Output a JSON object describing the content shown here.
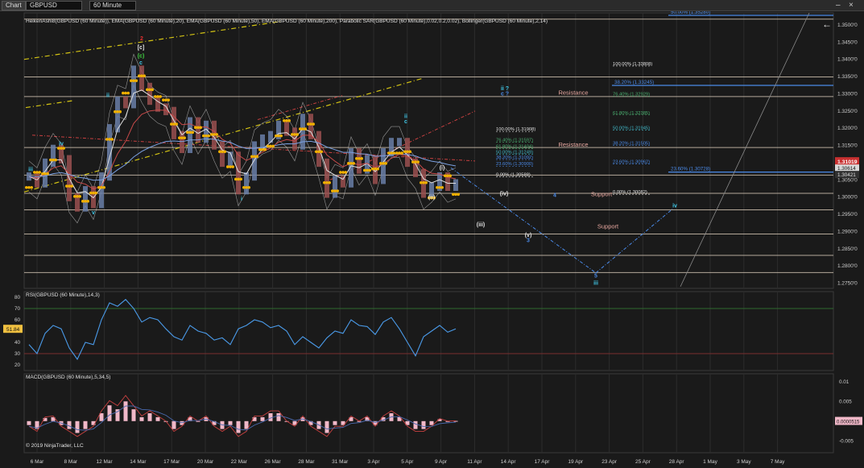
{
  "toolbar": {
    "chart_label": "Chart",
    "instrument": "GBPUSD",
    "timeframe": "60 Minute",
    "back_arrow": "←",
    "close": "×",
    "minimize": "–",
    "icons": [
      "chevron-down-icon",
      "back-arrow-icon",
      "close-icon"
    ]
  },
  "panels": {
    "price": {
      "indicators_label": "HeikenAshi8(GBPUSD (60 Minute)), EMA(GBPUSD (60 Minute),20), EMA(GBPUSD (60 Minute),50), EMA(GBPUSD (60 Minute),200), Parabolic SAR(GBPUSD (60 Minute),0.02,0.2,0.02), Bollinger(GBPUSD (60 Minute),2,14)"
    },
    "rsi": {
      "label": "RSI(GBPUSD (60 Minute),14,3)",
      "current_label": "51.84"
    },
    "macd": {
      "label": "MACD(GBPUSD (60 Minute),5,34,5)",
      "copyright": "© 2019 NinjaTrader, LLC",
      "current_label": "0.0000515"
    }
  },
  "colors": {
    "background": "#1a1a1a",
    "grid": "#2c2c2c",
    "level_line": "#e8d8c4",
    "yellow_channel": "#d4c414",
    "red_channel": "#c84040",
    "fib_blue": "#4a8ae8",
    "sar": "#f0b000",
    "rsi_line": "#4a9ae8",
    "macd_hist": "#f0b8c8",
    "wave_cyan": "#40c8e8",
    "current_price_bg": "#c83030",
    "rsi_tag": "#f0c040"
  },
  "chart_data": [
    {
      "name": "price",
      "type": "line",
      "x_tick_labels": [
        "6 Mar",
        "8 Mar",
        "12 Mar",
        "14 Mar",
        "17 Mar",
        "20 Mar",
        "22 Mar",
        "26 Mar",
        "28 Mar",
        "31 Mar",
        "3 Apr",
        "5 Apr",
        "9 Apr",
        "11 Apr",
        "14 Apr",
        "17 Apr",
        "19 Apr",
        "23 Apr",
        "25 Apr",
        "28 Apr",
        "1 May",
        "3 May",
        "7 May"
      ],
      "y_ticks": [
        1.275,
        1.28,
        1.285,
        1.29,
        1.295,
        1.3,
        1.305,
        1.31,
        1.315,
        1.32,
        1.325,
        1.33,
        1.335,
        1.34,
        1.345,
        1.35
      ],
      "y_tick_labels": [
        "1.2750'0",
        "1.2800'0",
        "1.2850'0",
        "1.2900'0",
        "1.2950'0",
        "1.3000'0",
        "1.3050'0",
        "1.3100'0",
        "1.3150'0",
        "1.3200'0",
        "1.3250'0",
        "1.3300'0",
        "1.3350'0",
        "1.3400'0",
        "1.3450'0",
        "1.3500'0"
      ],
      "ylim": [
        1.2735,
        1.3535
      ],
      "current_price": 1.31019,
      "current_price_label": "1.31019",
      "side_labels": [
        "1.30614",
        "1.30421"
      ],
      "close_series": [
        1.306,
        1.304,
        1.31,
        1.314,
        1.311,
        1.3,
        1.297,
        1.302,
        1.298,
        1.306,
        1.32,
        1.328,
        1.327,
        1.337,
        1.332,
        1.328,
        1.326,
        1.325,
        1.318,
        1.314,
        1.322,
        1.317,
        1.321,
        1.315,
        1.31,
        1.312,
        1.302,
        1.306,
        1.315,
        1.317,
        1.318,
        1.321,
        1.319,
        1.315,
        1.323,
        1.318,
        1.31,
        1.301,
        1.305,
        1.304,
        1.313,
        1.308,
        1.311,
        1.305,
        1.313,
        1.316,
        1.316,
        1.31,
        1.307,
        1.301,
        1.303,
        1.306,
        1.303,
        1.304
      ],
      "horizontal_levels": [
        1.3517,
        1.3349,
        1.3292,
        1.3144,
        1.3064,
        1.3011,
        1.2963,
        1.2893,
        1.2831,
        1.2781
      ],
      "level_labels": [
        {
          "text": "Resistance",
          "y": 1.3535
        },
        {
          "text": "Resistance",
          "y": 1.3293
        },
        {
          "text": "Resistance",
          "y": 1.3142
        },
        {
          "text": "Support",
          "y": 1.2998
        },
        {
          "text": "Support",
          "y": 1.2905
        }
      ],
      "fib_lines": [
        {
          "value": 1.3528,
          "label": "50.00% (1.35280)"
        },
        {
          "value": 1.33245,
          "label": "38.20% (1.33245)"
        },
        {
          "value": 1.30728,
          "label": "23.60% (1.30728)"
        }
      ],
      "fib_sets": [
        [
          {
            "label": "100.00% (1.31908)",
            "y": 1.31908,
            "color": "#e0e0e0"
          },
          {
            "label": "76.40% (1.31597)",
            "y": 1.31597,
            "color": "#4ab070"
          },
          {
            "label": "61.80% (1.31404)",
            "y": 1.31404,
            "color": "#4ab070"
          },
          {
            "label": "50.00% (1.31249)",
            "y": 1.31249,
            "color": "#40b8c8"
          },
          {
            "label": "38.20% (1.31092)",
            "y": 1.31092,
            "color": "#4a8ae8"
          },
          {
            "label": "23.60% (1.30900)",
            "y": 1.309,
            "color": "#4a8ae8"
          },
          {
            "label": "0.00% (1.30588)",
            "y": 1.30588,
            "color": "#e0e0e0"
          }
        ],
        [
          {
            "label": "100.00% (1.33808)",
            "y": 1.33808,
            "color": "#e0e0e0"
          },
          {
            "label": "76.40% (1.32929)",
            "y": 1.32929,
            "color": "#4ab070"
          },
          {
            "label": "61.80% (1.32385)",
            "y": 1.32385,
            "color": "#4ab070"
          },
          {
            "label": "50.00% (1.31945)",
            "y": 1.31945,
            "color": "#40b8c8"
          },
          {
            "label": "38.20% (1.31505)",
            "y": 1.31505,
            "color": "#4a8ae8"
          },
          {
            "label": "23.60% (1.30962)",
            "y": 1.30962,
            "color": "#4a8ae8"
          },
          {
            "label": "0.00% (1.30082)",
            "y": 1.30082,
            "color": "#e0e0e0"
          }
        ]
      ],
      "wave_labels": [
        {
          "text": "2",
          "color": "#e83030"
        },
        {
          "text": "[c]",
          "color": "#e0e0e0"
        },
        {
          "text": "(c)",
          "color": "#40d040"
        },
        {
          "text": "c",
          "color": "#40c8e8"
        },
        {
          "text": "iv",
          "color": "#40c8e8"
        },
        {
          "text": "iii",
          "color": "#40c8e8"
        },
        {
          "text": "v",
          "color": "#40c8e8"
        },
        {
          "text": "ii",
          "color": "#40c8e8"
        },
        {
          "text": "i",
          "color": "#40c8e8"
        },
        {
          "text": "ii",
          "color": "#40c8e8"
        },
        {
          "text": "c",
          "color": "#40c8e8"
        },
        {
          "text": "(i)",
          "color": "#e0e0e0"
        },
        {
          "text": "(ii)",
          "color": "#e0e0e0"
        },
        {
          "text": "ii ?",
          "color": "#40c8e8"
        },
        {
          "text": "c ?",
          "color": "#4a8ae8"
        },
        {
          "text": "(iv)",
          "color": "#e0e0e0"
        },
        {
          "text": "4",
          "color": "#4a8ae8"
        },
        {
          "text": "(iii)",
          "color": "#e0e0e0"
        },
        {
          "text": "(v)",
          "color": "#e0e0e0"
        },
        {
          "text": "3",
          "color": "#4a8ae8"
        },
        {
          "text": "5",
          "color": "#4a8ae8"
        },
        {
          "text": "iii",
          "color": "#40c8e8"
        },
        {
          "text": "iv",
          "color": "#40c8e8"
        }
      ]
    },
    {
      "name": "rsi",
      "type": "line",
      "y_tick_labels": [
        "80",
        "70",
        "60",
        "50",
        "40",
        "30",
        "20"
      ],
      "ylim": [
        15,
        85
      ],
      "levels": [
        70,
        30
      ],
      "values": [
        38,
        30,
        48,
        55,
        52,
        35,
        25,
        40,
        38,
        60,
        75,
        72,
        78,
        70,
        58,
        62,
        60,
        52,
        45,
        42,
        55,
        50,
        48,
        42,
        44,
        38,
        52,
        55,
        60,
        58,
        53,
        55,
        50,
        38,
        45,
        40,
        35,
        44,
        50,
        48,
        60,
        55,
        54,
        47,
        58,
        62,
        52,
        40,
        28,
        45,
        50,
        55,
        49,
        52
      ]
    },
    {
      "name": "macd",
      "type": "line",
      "y_tick_labels": [
        "0.01",
        "0.005",
        "0",
        "-0.005"
      ],
      "ylim": [
        -0.008,
        0.012
      ],
      "values": [
        -0.001,
        -0.002,
        0.0008,
        0.001,
        -0.001,
        -0.002,
        -0.003,
        -0.002,
        -0.001,
        0.002,
        0.004,
        0.003,
        0.005,
        0.003,
        0.001,
        0.002,
        0.001,
        0.0,
        -0.002,
        -0.001,
        0.001,
        0.0,
        0.001,
        -0.001,
        -0.002,
        -0.001,
        -0.003,
        -0.002,
        0.001,
        0.001,
        0.002,
        0.002,
        0.0,
        -0.001,
        0.001,
        -0.001,
        -0.002,
        -0.003,
        -0.001,
        -0.001,
        0.001,
        0.0,
        0.001,
        -0.001,
        0.001,
        0.002,
        0.001,
        -0.001,
        -0.002,
        -0.002,
        -0.001,
        0.0005,
        0.0,
        5.15e-05
      ]
    }
  ]
}
